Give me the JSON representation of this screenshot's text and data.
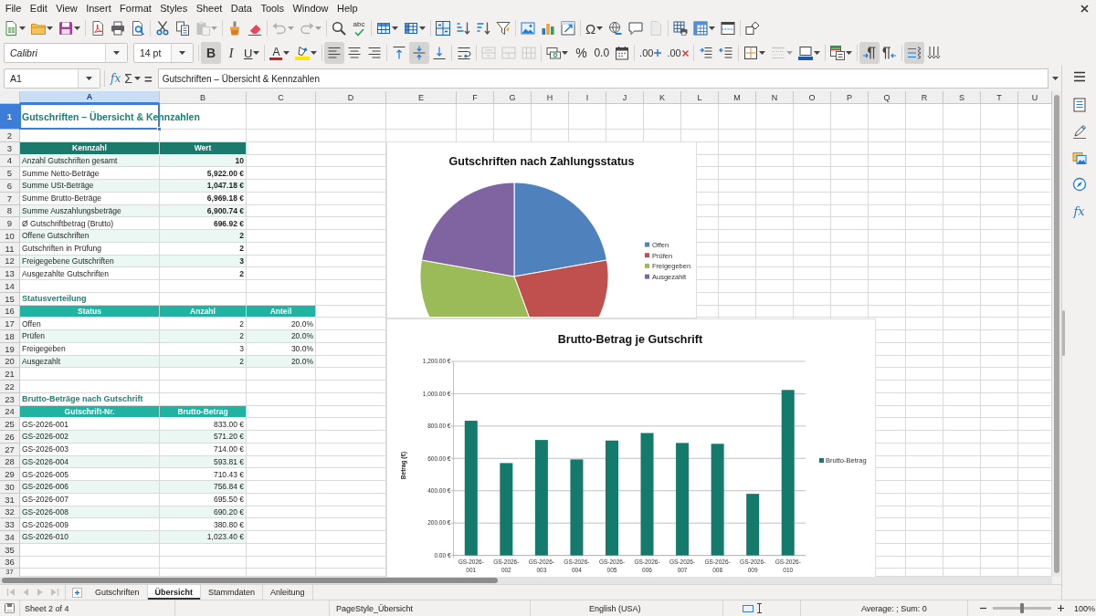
{
  "menu_bar": {
    "items": [
      "File",
      "Edit",
      "View",
      "Insert",
      "Format",
      "Styles",
      "Sheet",
      "Data",
      "Tools",
      "Window",
      "Help"
    ]
  },
  "standard_toolbar": {
    "groups": [
      [
        {
          "kind": "new",
          "dropdown": true,
          "disabled": false
        },
        {
          "kind": "open",
          "dropdown": true,
          "disabled": false
        },
        {
          "kind": "save",
          "dropdown": true,
          "disabled": false
        }
      ],
      [
        {
          "kind": "export_pdf",
          "dropdown": false,
          "disabled": false
        },
        {
          "kind": "print",
          "dropdown": false,
          "disabled": false
        },
        {
          "kind": "print_preview",
          "dropdown": false,
          "disabled": false
        }
      ],
      [
        {
          "kind": "cut",
          "dropdown": false,
          "disabled": false
        },
        {
          "kind": "copy",
          "dropdown": false,
          "disabled": false
        },
        {
          "kind": "paste",
          "dropdown": true,
          "disabled": true
        }
      ],
      [
        {
          "kind": "clone_format",
          "dropdown": false,
          "disabled": false
        },
        {
          "kind": "clear_format",
          "dropdown": false,
          "disabled": false
        }
      ],
      [
        {
          "kind": "undo",
          "dropdown": true,
          "disabled": true
        },
        {
          "kind": "redo",
          "dropdown": true,
          "disabled": true
        }
      ],
      [
        {
          "kind": "find",
          "dropdown": false,
          "disabled": false
        },
        {
          "kind": "spelling",
          "glyph": "abc",
          "dropdown": false,
          "disabled": false
        }
      ],
      [
        {
          "kind": "rows",
          "dropdown": true,
          "disabled": false
        },
        {
          "kind": "columns",
          "dropdown": true,
          "disabled": false
        }
      ],
      [
        {
          "kind": "sort",
          "dropdown": false,
          "disabled": false
        },
        {
          "kind": "sort_ascending",
          "dropdown": false,
          "disabled": false
        },
        {
          "kind": "sort_descending",
          "dropdown": false,
          "disabled": false
        },
        {
          "kind": "autofilter",
          "dropdown": false,
          "disabled": false
        }
      ],
      [
        {
          "kind": "image",
          "dropdown": false,
          "disabled": false
        },
        {
          "kind": "chart",
          "dropdown": false,
          "disabled": false
        },
        {
          "kind": "pivot_table",
          "dropdown": false,
          "disabled": false
        }
      ],
      [
        {
          "kind": "special_character",
          "glyph": "Ω",
          "dropdown": true,
          "disabled": false
        },
        {
          "kind": "hyperlink",
          "dropdown": false,
          "disabled": false
        },
        {
          "kind": "comment",
          "dropdown": false,
          "disabled": false
        },
        {
          "kind": "header_footer",
          "dropdown": false,
          "disabled": true
        }
      ],
      [
        {
          "kind": "print_area",
          "dropdown": false,
          "disabled": false
        },
        {
          "kind": "freeze",
          "dropdown": true,
          "disabled": false
        },
        {
          "kind": "split_window",
          "dropdown": false,
          "disabled": false
        }
      ],
      [
        {
          "kind": "draw_functions",
          "dropdown": false,
          "disabled": false
        }
      ]
    ]
  },
  "formatting_toolbar": {
    "font_name": "Calibri",
    "font_size": "14 pt",
    "groups": [
      [
        {
          "kind": "bold",
          "glyph": "B",
          "on": true,
          "dropdown": false,
          "disabled": false
        },
        {
          "kind": "italic",
          "glyph": "I",
          "on": false,
          "dropdown": false,
          "disabled": false
        },
        {
          "kind": "underline",
          "glyph": "U",
          "on": false,
          "dropdown": true,
          "disabled": false
        }
      ],
      [
        {
          "kind": "font_color",
          "glyph": "A",
          "on": false,
          "dropdown": true,
          "disabled": false
        },
        {
          "kind": "highlight",
          "on": false,
          "dropdown": true,
          "disabled": false
        }
      ],
      [
        {
          "kind": "align_left",
          "on": true,
          "dropdown": false,
          "disabled": false
        },
        {
          "kind": "align_center",
          "on": false,
          "dropdown": false,
          "disabled": false
        },
        {
          "kind": "align_right",
          "on": false,
          "dropdown": false,
          "disabled": false
        }
      ],
      [
        {
          "kind": "align_top",
          "on": false,
          "dropdown": false,
          "disabled": false
        },
        {
          "kind": "align_middle",
          "on": true,
          "dropdown": false,
          "disabled": false
        },
        {
          "kind": "align_bottom",
          "on": false,
          "dropdown": false,
          "disabled": false
        }
      ],
      [
        {
          "kind": "wrap_text",
          "on": false,
          "dropdown": false,
          "disabled": false
        }
      ],
      [
        {
          "kind": "merge_center",
          "on": false,
          "dropdown": false,
          "disabled": true
        },
        {
          "kind": "merge",
          "on": false,
          "dropdown": false,
          "disabled": true
        },
        {
          "kind": "unmerge",
          "on": false,
          "dropdown": false,
          "disabled": true
        }
      ],
      [
        {
          "kind": "currency_format",
          "on": false,
          "dropdown": true,
          "disabled": false
        },
        {
          "kind": "percent",
          "glyph": "%",
          "on": false,
          "dropdown": false,
          "disabled": false
        },
        {
          "kind": "standard_format",
          "glyph": "0.0",
          "on": false,
          "dropdown": false,
          "disabled": false
        },
        {
          "kind": "date_format",
          "on": false,
          "dropdown": false,
          "disabled": false
        }
      ],
      [
        {
          "kind": "add_decimal",
          "glyph": ".00",
          "on": false,
          "dropdown": false,
          "disabled": false
        },
        {
          "kind": "delete_decimal",
          "glyph": ".00",
          "on": false,
          "dropdown": false,
          "disabled": false
        }
      ],
      [
        {
          "kind": "indent_increase",
          "on": false,
          "dropdown": false,
          "disabled": false
        },
        {
          "kind": "indent_decrease",
          "on": false,
          "dropdown": false,
          "disabled": false
        }
      ],
      [
        {
          "kind": "borders",
          "on": false,
          "dropdown": true,
          "disabled": false
        },
        {
          "kind": "border_style",
          "on": false,
          "dropdown": true,
          "disabled": true
        },
        {
          "kind": "border_color",
          "on": false,
          "dropdown": true,
          "disabled": false
        }
      ],
      [
        {
          "kind": "conditional_format",
          "on": false,
          "dropdown": true,
          "disabled": false
        }
      ],
      [
        {
          "kind": "left_to_right",
          "on": true,
          "dropdown": false,
          "disabled": false
        },
        {
          "kind": "right_to_left",
          "on": false,
          "dropdown": false,
          "disabled": false
        }
      ],
      [
        {
          "kind": "text_horizontal",
          "on": true,
          "dropdown": false,
          "disabled": false
        },
        {
          "kind": "text_vertical",
          "on": false,
          "dropdown": false,
          "disabled": false
        }
      ]
    ]
  },
  "formula_bar": {
    "name_box": "A1",
    "buttons": [
      {
        "kind": "function_wizard",
        "glyph": "fx",
        "dropdown": false
      },
      {
        "kind": "sum",
        "glyph": "Σ",
        "dropdown": true
      },
      {
        "kind": "formula",
        "glyph": "=",
        "dropdown": false
      }
    ],
    "content": "Gutschriften – Übersicht & Kennzahlen"
  },
  "sheet": {
    "columns": [
      {
        "label": "A",
        "selected": true
      },
      {
        "label": "B",
        "selected": false
      },
      {
        "label": "C",
        "selected": false
      },
      {
        "label": "D",
        "selected": false
      },
      {
        "label": "E",
        "selected": false
      },
      {
        "label": "F",
        "selected": false
      },
      {
        "label": "G",
        "selected": false
      },
      {
        "label": "H",
        "selected": false
      },
      {
        "label": "I",
        "selected": false
      },
      {
        "label": "J",
        "selected": false
      },
      {
        "label": "K",
        "selected": false
      },
      {
        "label": "L",
        "selected": false
      },
      {
        "label": "M",
        "selected": false
      },
      {
        "label": "N",
        "selected": false
      },
      {
        "label": "O",
        "selected": false
      },
      {
        "label": "P",
        "selected": false
      },
      {
        "label": "Q",
        "selected": false
      },
      {
        "label": "R",
        "selected": false
      },
      {
        "label": "S",
        "selected": false
      },
      {
        "label": "T",
        "selected": false
      },
      {
        "label": "U",
        "selected": false
      }
    ],
    "rows": [
      {
        "label": "1",
        "selected": true,
        "kind": "title",
        "cells": [
          "Gutschriften – Übersicht & Kennzahlen"
        ]
      },
      {
        "label": "2",
        "selected": false,
        "kind": "blank"
      },
      {
        "label": "3",
        "selected": false,
        "kind": "header",
        "color": "#1b7a6c",
        "cells": [
          "Kennzahl",
          "Wert"
        ]
      },
      {
        "label": "4",
        "selected": false,
        "kind": "kpi",
        "shaded": true,
        "cells": [
          "Anzahl Gutschriften gesamt",
          "10"
        ]
      },
      {
        "label": "5",
        "selected": false,
        "kind": "kpi",
        "shaded": false,
        "cells": [
          "Summe Netto-Beträge",
          "5,922.00 €"
        ]
      },
      {
        "label": "6",
        "selected": false,
        "kind": "kpi",
        "shaded": true,
        "cells": [
          "Summe USt-Beträge",
          "1,047.18 €"
        ]
      },
      {
        "label": "7",
        "selected": false,
        "kind": "kpi",
        "shaded": false,
        "cells": [
          "Summe Brutto-Beträge",
          "6,969.18 €"
        ]
      },
      {
        "label": "8",
        "selected": false,
        "kind": "kpi",
        "shaded": true,
        "cells": [
          "Summe Auszahlungsbeträge",
          "6,900.74 €"
        ]
      },
      {
        "label": "9",
        "selected": false,
        "kind": "kpi",
        "shaded": false,
        "cells": [
          "Ø Gutschriftbetrag (Brutto)",
          "696.92 €"
        ]
      },
      {
        "label": "10",
        "selected": false,
        "kind": "kpi",
        "shaded": true,
        "cells": [
          "Offene Gutschriften",
          "2"
        ]
      },
      {
        "label": "11",
        "selected": false,
        "kind": "kpi",
        "shaded": false,
        "cells": [
          "Gutschriften in Prüfung",
          "2"
        ]
      },
      {
        "label": "12",
        "selected": false,
        "kind": "kpi",
        "shaded": true,
        "cells": [
          "Freigegebene Gutschriften",
          "3"
        ]
      },
      {
        "label": "13",
        "selected": false,
        "kind": "kpi",
        "shaded": false,
        "cells": [
          "Ausgezahlte Gutschriften",
          "2"
        ]
      },
      {
        "label": "14",
        "selected": false,
        "kind": "blank"
      },
      {
        "label": "15",
        "selected": false,
        "kind": "section",
        "cells": [
          "Statusverteilung"
        ]
      },
      {
        "label": "16",
        "selected": false,
        "kind": "header",
        "color": "#21b3a1",
        "cells": [
          "Status",
          "Anzahl",
          "Anteil"
        ]
      },
      {
        "label": "17",
        "selected": false,
        "kind": "row",
        "shaded": false,
        "cells": [
          "Offen",
          "2",
          "20.0%"
        ]
      },
      {
        "label": "18",
        "selected": false,
        "kind": "row",
        "shaded": true,
        "cells": [
          "Prüfen",
          "2",
          "20.0%"
        ]
      },
      {
        "label": "19",
        "selected": false,
        "kind": "row",
        "shaded": false,
        "cells": [
          "Freigegeben",
          "3",
          "30.0%"
        ]
      },
      {
        "label": "20",
        "selected": false,
        "kind": "row",
        "shaded": true,
        "cells": [
          "Ausgezahlt",
          "2",
          "20.0%"
        ]
      },
      {
        "label": "21",
        "selected": false,
        "kind": "blank"
      },
      {
        "label": "22",
        "selected": false,
        "kind": "blank"
      },
      {
        "label": "23",
        "selected": false,
        "kind": "section",
        "cells": [
          "Brutto-Beträge nach Gutschrift"
        ]
      },
      {
        "label": "24",
        "selected": false,
        "kind": "header",
        "color": "#21b3a1",
        "cells": [
          "Gutschrift-Nr.",
          "Brutto-Betrag"
        ]
      },
      {
        "label": "25",
        "selected": false,
        "kind": "row",
        "shaded": false,
        "cells": [
          "GS-2026-001",
          "833.00 €"
        ]
      },
      {
        "label": "26",
        "selected": false,
        "kind": "row",
        "shaded": true,
        "cells": [
          "GS-2026-002",
          "571.20 €"
        ]
      },
      {
        "label": "27",
        "selected": false,
        "kind": "row",
        "shaded": false,
        "cells": [
          "GS-2026-003",
          "714.00 €"
        ]
      },
      {
        "label": "28",
        "selected": false,
        "kind": "row",
        "shaded": true,
        "cells": [
          "GS-2026-004",
          "593.81 €"
        ]
      },
      {
        "label": "29",
        "selected": false,
        "kind": "row",
        "shaded": false,
        "cells": [
          "GS-2026-005",
          "710.43 €"
        ]
      },
      {
        "label": "30",
        "selected": false,
        "kind": "row",
        "shaded": true,
        "cells": [
          "GS-2026-006",
          "756.84 €"
        ]
      },
      {
        "label": "31",
        "selected": false,
        "kind": "row",
        "shaded": false,
        "cells": [
          "GS-2026-007",
          "695.50 €"
        ]
      },
      {
        "label": "32",
        "selected": false,
        "kind": "row",
        "shaded": true,
        "cells": [
          "GS-2026-008",
          "690.20 €"
        ]
      },
      {
        "label": "33",
        "selected": false,
        "kind": "row",
        "shaded": false,
        "cells": [
          "GS-2026-009",
          "380.80 €"
        ]
      },
      {
        "label": "34",
        "selected": false,
        "kind": "row",
        "shaded": true,
        "cells": [
          "GS-2026-010",
          "1,023.40 €"
        ]
      },
      {
        "label": "35",
        "selected": false,
        "kind": "blank"
      },
      {
        "label": "36",
        "selected": false,
        "kind": "blank"
      },
      {
        "label": "37",
        "selected": false,
        "kind": "blank"
      }
    ]
  },
  "charts": [
    {
      "chart_data": {
        "type": "pie",
        "title": "Gutschriften nach Zahlungsstatus",
        "categories": [
          "Offen",
          "Prüfen",
          "Freigegeben",
          "Ausgezahlt"
        ],
        "values": [
          22.2,
          22.2,
          33.4,
          22.2
        ],
        "colors": [
          "#4f81bd",
          "#c0504d",
          "#9bbb59",
          "#8064a2"
        ],
        "legend": "right"
      }
    },
    {
      "chart_data": {
        "type": "bar",
        "title": "Brutto-Betrag je Gutschrift",
        "ylabel": "Betrag (€)",
        "categories": [
          "GS-2026-001",
          "GS-2026-002",
          "GS-2026-003",
          "GS-2026-004",
          "GS-2026-005",
          "GS-2026-006",
          "GS-2026-007",
          "GS-2026-008",
          "GS-2026-009",
          "GS-2026-010"
        ],
        "series": [
          {
            "name": "Brutto-Betrag",
            "color": "#137a6c",
            "values": [
              833.0,
              571.2,
              714.0,
              593.81,
              710.43,
              756.84,
              695.5,
              690.2,
              380.8,
              1023.4
            ]
          }
        ],
        "ylim": [
          0,
          1200
        ],
        "yticks": [
          {
            "value": 0,
            "label": "0.00 €"
          },
          {
            "value": 200,
            "label": "200.00 €"
          },
          {
            "value": 400,
            "label": "400.00 €"
          },
          {
            "value": 600,
            "label": "600.00 €"
          },
          {
            "value": 800,
            "label": "800.00 €"
          },
          {
            "value": 1000,
            "label": "1,000.00 €"
          },
          {
            "value": 1200,
            "label": "1,200.00 €"
          }
        ],
        "grid": true,
        "legend": "right"
      }
    }
  ],
  "sheet_tabs": {
    "nav_buttons": [
      {
        "kind": "first",
        "disabled": true
      },
      {
        "kind": "previous",
        "disabled": true
      },
      {
        "kind": "next",
        "disabled": true
      },
      {
        "kind": "last",
        "disabled": true
      }
    ],
    "tabs": [
      {
        "label": "Gutschriften",
        "selected": false
      },
      {
        "label": "Übersicht",
        "selected": true
      },
      {
        "label": "Stammdaten",
        "selected": false
      },
      {
        "label": "Anleitung",
        "selected": false
      }
    ]
  },
  "sidebar": {
    "items": [
      {
        "kind": "menu"
      },
      {
        "kind": "properties"
      },
      {
        "kind": "styles"
      },
      {
        "kind": "gallery"
      },
      {
        "kind": "navigator"
      },
      {
        "kind": "functions",
        "glyph": "fx"
      }
    ]
  },
  "status_bar": {
    "sheet_info": "Sheet 2 of 4",
    "page_style": "PageStyle_Übersicht",
    "language": "English (USA)",
    "summary": "Average: ; Sum: 0",
    "zoom": {
      "level": 0.5,
      "reading": "100%"
    }
  }
}
